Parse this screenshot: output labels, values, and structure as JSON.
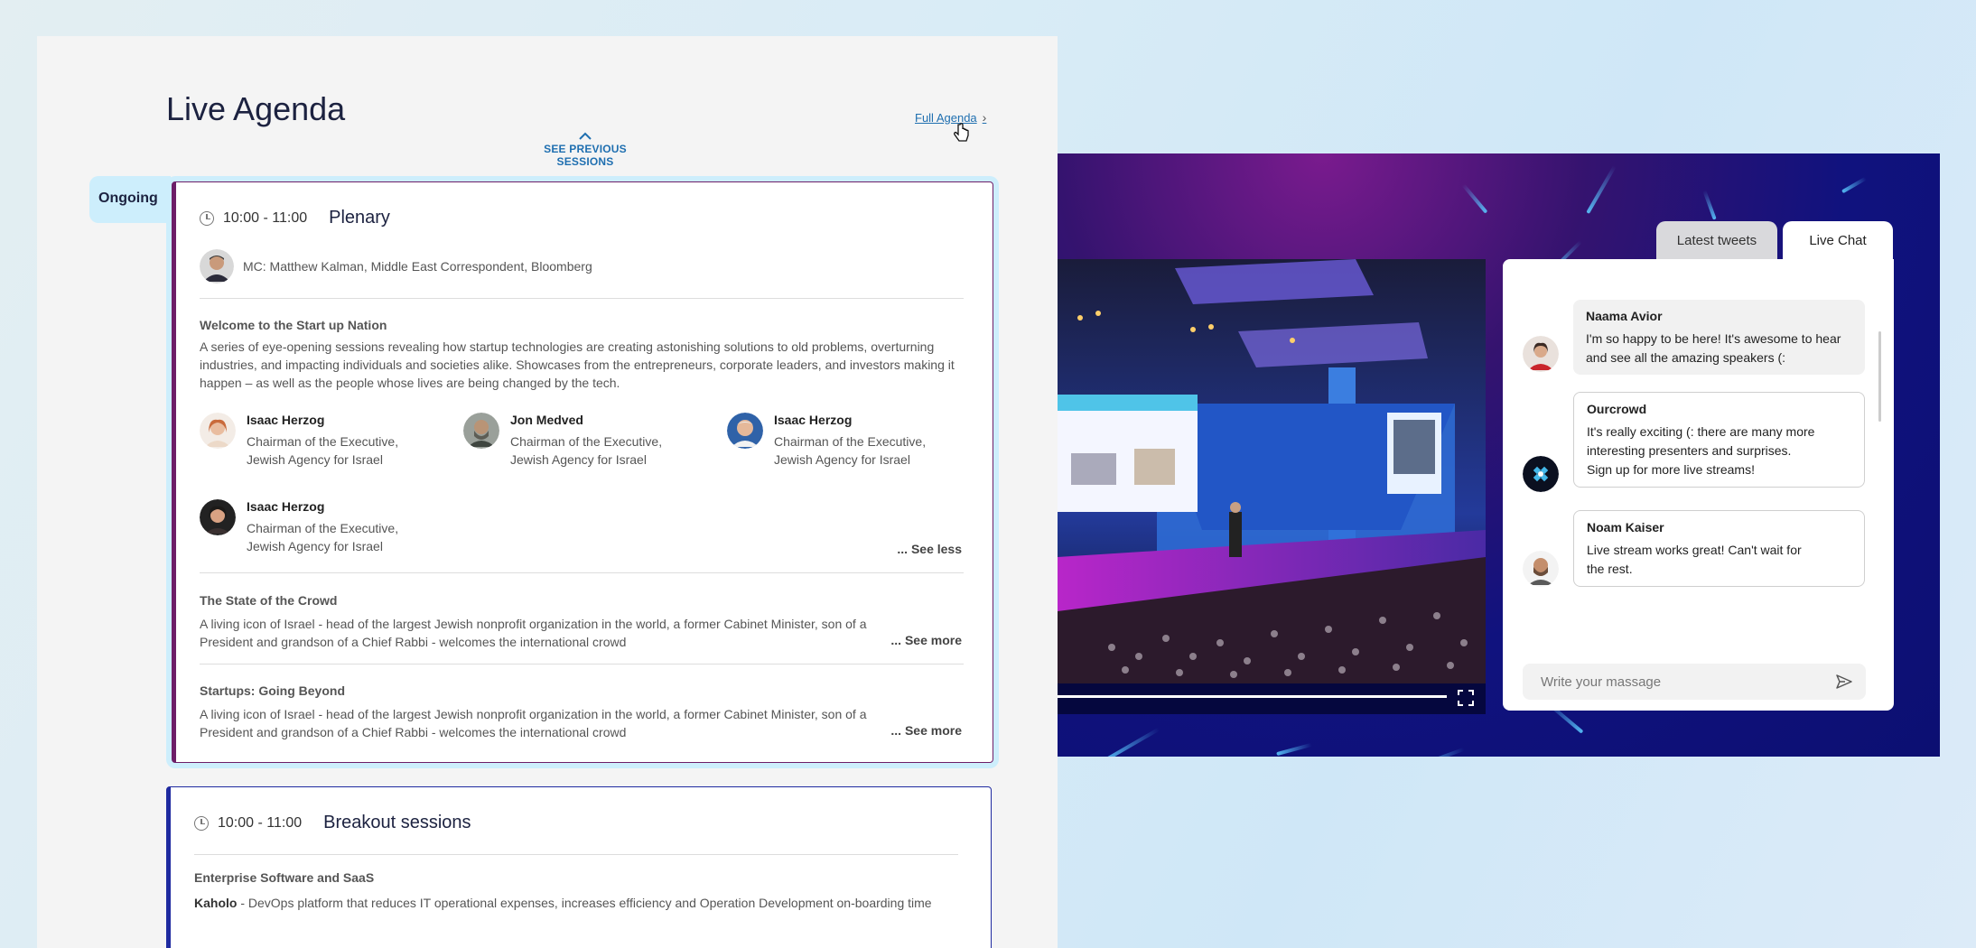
{
  "agenda": {
    "title": "Live Agenda",
    "full_agenda_link": "Full Agenda",
    "see_previous": "SEE PREVIOUS SESSIONS",
    "ongoing_label": "Ongoing",
    "sessions": [
      {
        "time": "10:00 - 11:00",
        "name": "Plenary",
        "mc": "MC: Matthew Kalman, Middle East Correspondent, Bloomberg",
        "talks": [
          {
            "title": "Welcome to the Start up Nation",
            "description": "A series of eye-opening sessions revealing how startup technologies are creating astonishing solutions to old problems, overturning industries, and impacting individuals and societies alike.  Showcases from the entrepreneurs, corporate leaders, and investors making it happen – as well as the people whose lives are being changed by the tech.",
            "speakers": [
              {
                "name": "Isaac Herzog",
                "role_line1": "Chairman of the Executive,",
                "role_line2": "Jewish Agency for Israel"
              },
              {
                "name": "Jon Medved",
                "role_line1": "Chairman of the Executive,",
                "role_line2": "Jewish Agency for Israel"
              },
              {
                "name": "Isaac Herzog",
                "role_line1": "Chairman of the Executive,",
                "role_line2": "Jewish Agency for Israel"
              },
              {
                "name": "Isaac Herzog",
                "role_line1": "Chairman of the Executive,",
                "role_line2": "Jewish Agency for Israel"
              }
            ],
            "toggle": "... See less"
          },
          {
            "title": "The State of the Crowd",
            "description": "A living icon of Israel - head of the largest Jewish nonprofit organization in the world, a former Cabinet Minister, son of a President and grandson of a Chief Rabbi - welcomes the international crowd",
            "toggle": "... See more"
          },
          {
            "title": "Startups: Going Beyond",
            "description": "A living icon of Israel - head of the largest Jewish nonprofit organization in the world, a former Cabinet Minister, son of a President and grandson of a Chief Rabbi - welcomes the international crowd",
            "toggle": "... See more"
          }
        ]
      },
      {
        "time": "10:00 - 11:00",
        "name": "Breakout sessions",
        "track": "Enterprise Software and SaaS",
        "company": "Kaholo",
        "company_desc": " - DevOps platform that reduces IT operational expenses, increases efficiency and Operation Development on-boarding time"
      }
    ]
  },
  "chat": {
    "tabs": [
      "Latest tweets",
      "Live Chat"
    ],
    "active_tab": "Live Chat",
    "messages": [
      {
        "author": "Naama Avior",
        "text_line1": "I'm so happy to be here! It's awesome to hear",
        "text_line2": "and see all the amazing speakers (:"
      },
      {
        "author": "Ourcrowd",
        "text_line1": "It's really exciting (: there are many more",
        "text_line2": "interesting presenters and surprises.",
        "text_line3": "Sign up for more live streams!"
      },
      {
        "author": "Noam Kaiser",
        "text_line1": "Live stream works great! Can't wait for",
        "text_line2": "the rest."
      }
    ],
    "input_placeholder": "Write your massage"
  },
  "video": {
    "progress": 0.91
  },
  "colors": {
    "accent_blue": "#1f6fb0",
    "plenary_border": "#6d1e68",
    "breakout_border": "#1f2aa0",
    "ongoing_bg": "#cdeefc"
  }
}
